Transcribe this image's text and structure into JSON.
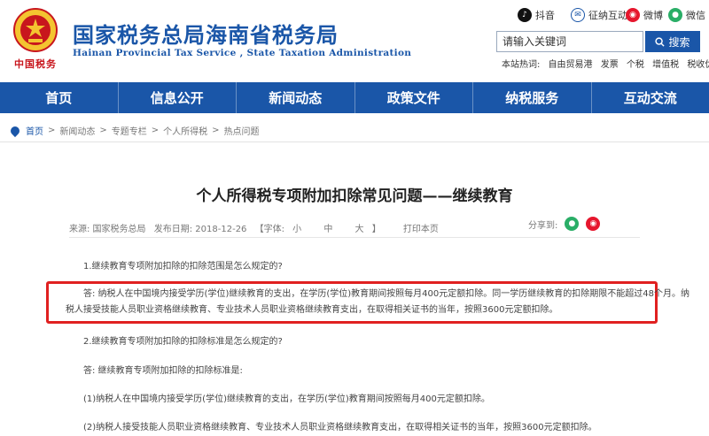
{
  "header": {
    "title": "国家税务总局海南省税务局",
    "subtitle": "Hainan Provincial Tax Service , State Taxation Administration",
    "logo_text": "中国税务",
    "social": [
      {
        "label": "抖音",
        "icon": "tiktok-icon"
      },
      {
        "label": "征纳互动",
        "icon": "interaction-icon"
      },
      {
        "label": "微博",
        "icon": "weibo-icon"
      },
      {
        "label": "微信",
        "icon": "wechat-icon"
      }
    ],
    "search": {
      "placeholder": "请输入关键词",
      "button_label": "搜索"
    },
    "hot_words": {
      "label": "本站热词:",
      "items": [
        "自由贸易港",
        "发票",
        "个税",
        "增值税",
        "税收优惠"
      ]
    }
  },
  "nav": {
    "items": [
      "首页",
      "信息公开",
      "新闻动态",
      "政策文件",
      "纳税服务",
      "互动交流"
    ]
  },
  "breadcrumb": {
    "items": [
      "首页",
      "新闻动态",
      "专题专栏",
      "个人所得税",
      "热点问题"
    ],
    "separator": ">"
  },
  "article": {
    "title": "个人所得税专项附加扣除常见问题——继续教育",
    "meta": {
      "source": "来源: 国家税务总局",
      "date": "发布日期: 2018-12-26",
      "font_label": "【字体:",
      "font_sizes": [
        "小",
        "中",
        "大"
      ],
      "font_close": "】",
      "print": "打印本页",
      "share_label": "分享到:"
    },
    "q1": "1.继续教育专项附加扣除的扣除范围是怎么规定的?",
    "a1_line1": "答: 纳税人在中国境内接受学历(学位)继续教育的支出，在学历(学位)教育期间按照每月400元定额扣除。同一学历继续教育的扣除期限不能超过48个月。纳",
    "a1_line2": "税人接受技能人员职业资格继续教育、专业技术人员职业资格继续教育支出，在取得相关证书的当年，按照3600元定额扣除。",
    "q2": "2.继续教育专项附加扣除的扣除标准是怎么规定的?",
    "a2_intro": "答: 继续教育专项附加扣除的扣除标准是:",
    "a2_item1": "(1)纳税人在中国境内接受学历(学位)继续教育的支出，在学历(学位)教育期间按照每月400元定额扣除。",
    "a2_item2": "(2)纳税人接受技能人员职业资格继续教育、专业技术人员职业资格继续教育支出，在取得相关证书的当年，按照3600元定额扣除。"
  },
  "colors": {
    "brand_blue": "#1a56a8",
    "highlight_red": "#e02020"
  }
}
